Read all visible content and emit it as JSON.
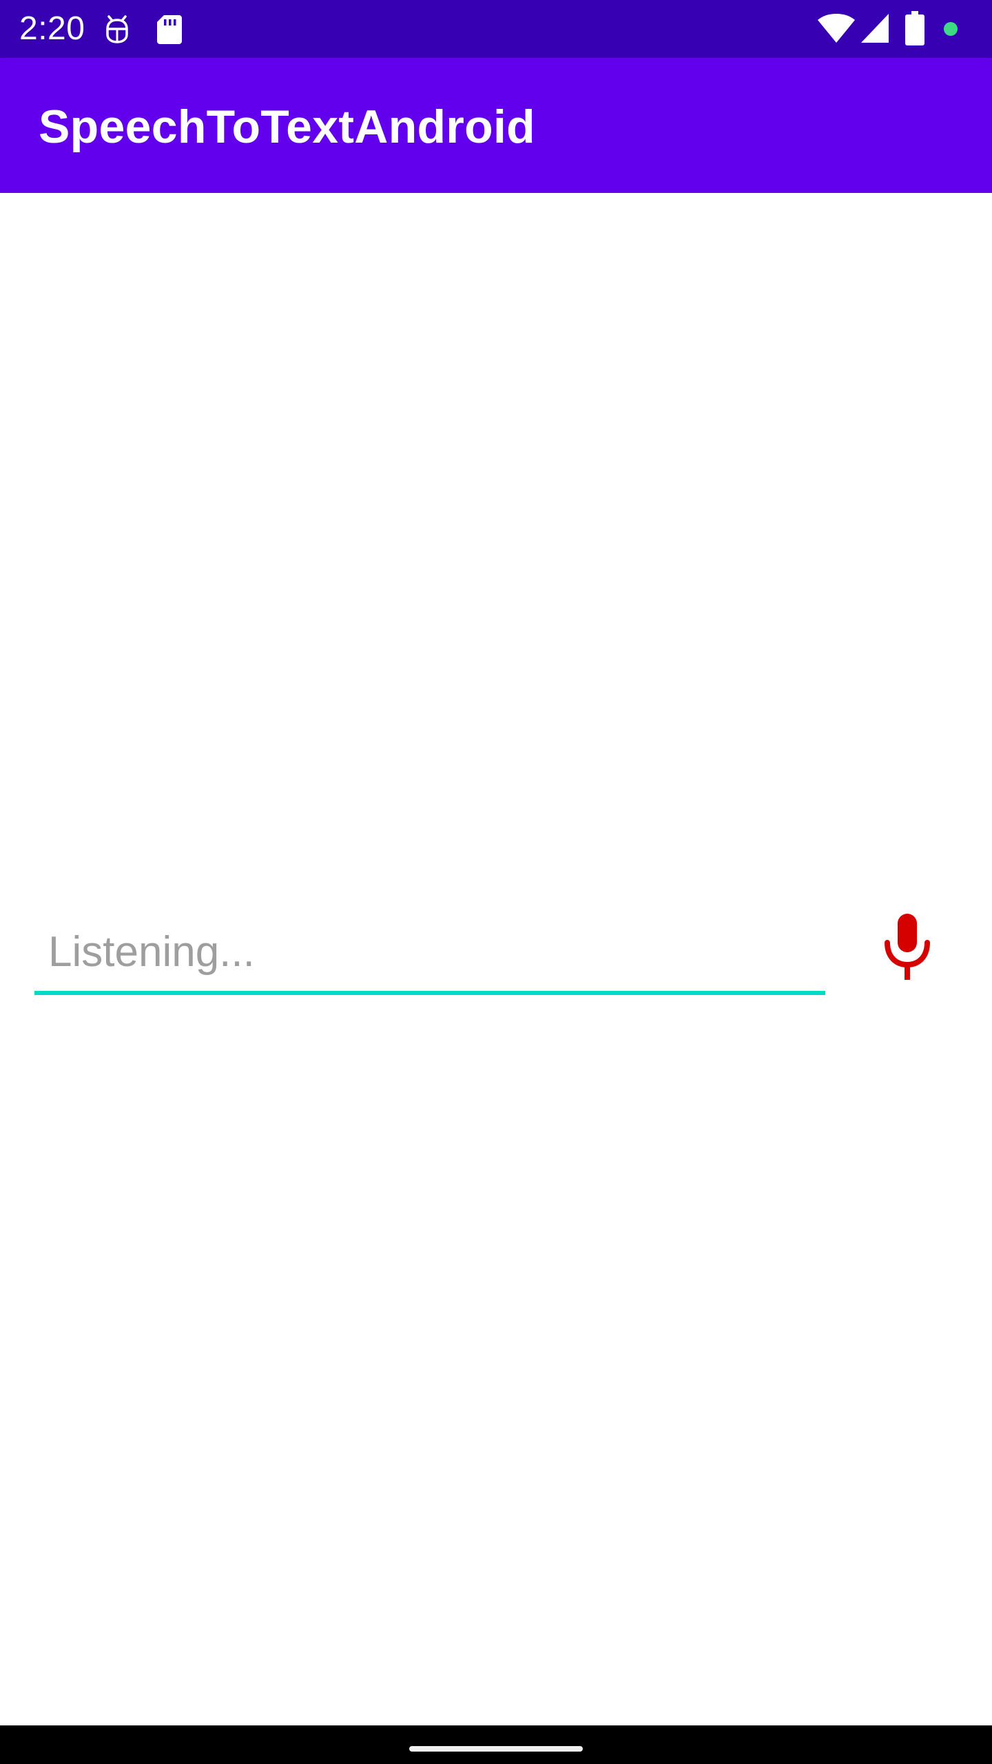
{
  "status_bar": {
    "time": "2:20",
    "background": "#3700b3",
    "left_icons": [
      "debug-bug-icon",
      "sd-card-icon"
    ],
    "right_icons": [
      "wifi-icon",
      "cellular-signal-icon",
      "battery-icon",
      "privacy-indicator-dot-icon"
    ],
    "indicator_color": "#3ddc84"
  },
  "app_bar": {
    "title": "SpeechToTextAndroid",
    "background": "#6200ee"
  },
  "speech_field": {
    "value": "",
    "placeholder": "Listening...",
    "underline_color": "#03dac5"
  },
  "mic_button": {
    "icon": "microphone-icon",
    "color": "#d50000"
  },
  "nav_bar": {
    "background": "#000000"
  }
}
